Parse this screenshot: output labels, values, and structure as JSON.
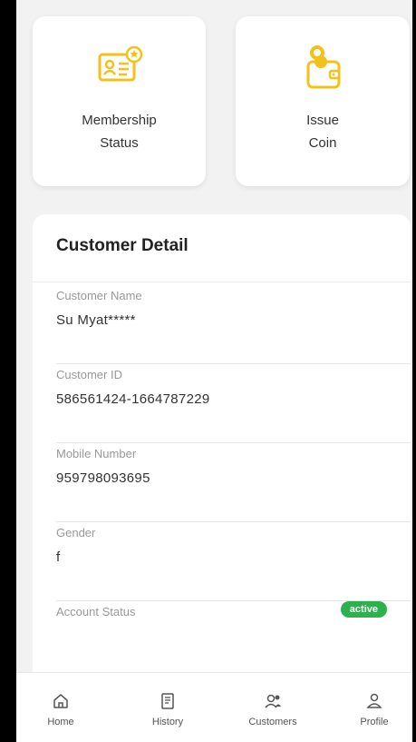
{
  "cards": [
    {
      "label": "Membership\nStatus",
      "icon": "membership-card-icon"
    },
    {
      "label": "Issue\nCoin",
      "icon": "coin-wallet-icon"
    }
  ],
  "detail": {
    "title": "Customer Detail",
    "fields": [
      {
        "label": "Customer Name",
        "value": "Su Myat*****"
      },
      {
        "label": "Customer ID",
        "value": "586561424-1664787229"
      },
      {
        "label": "Mobile Number",
        "value": "959798093695"
      },
      {
        "label": "Gender",
        "value": "f"
      },
      {
        "label": "Account Status",
        "badge": "active"
      }
    ]
  },
  "nav": [
    {
      "label": "Home",
      "icon": "home-icon"
    },
    {
      "label": "History",
      "icon": "history-icon"
    },
    {
      "label": "Customers",
      "icon": "customers-icon"
    },
    {
      "label": "Profile",
      "icon": "profile-icon"
    }
  ],
  "colors": {
    "accent": "#f2c21b",
    "badge": "#2bb24c"
  }
}
